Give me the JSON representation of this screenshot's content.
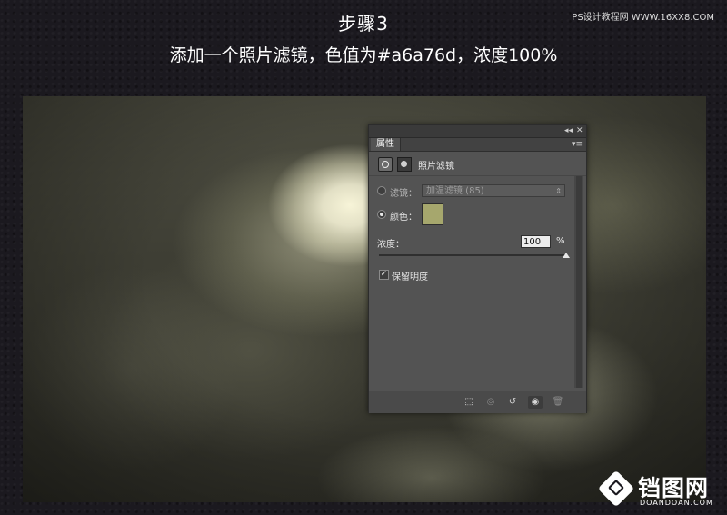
{
  "header": {
    "step_title": "步骤3",
    "description": "添加一个照片滤镜，色值为#a6a76d，浓度100%",
    "watermark": "PS设计教程网 WWW.16XX8.COM"
  },
  "panel": {
    "tab_label": "属性",
    "collapse_label": "◂◂",
    "close_label": "✕",
    "menu_label": "▾≡",
    "adjustment_name": "照片滤镜",
    "filter_label": "滤镜：",
    "filter_value": "加温滤镜 (85)",
    "color_label": "颜色：",
    "color_hex": "#a6a76d",
    "density_label": "浓度：",
    "density_value": "100",
    "density_unit": "%",
    "density_level": 1.0,
    "preserve_label": "保留明度",
    "preserve_checked": true,
    "filter_selected": false,
    "color_selected": true
  },
  "footer_icons": [
    {
      "name": "clip-to-layer-icon",
      "glyph": "⬚"
    },
    {
      "name": "view-previous-icon",
      "glyph": "◎"
    },
    {
      "name": "reset-icon",
      "glyph": "↺"
    },
    {
      "name": "visibility-icon",
      "glyph": "◉"
    },
    {
      "name": "delete-icon",
      "glyph": "🗑"
    }
  ],
  "logo": {
    "text": "铛图网",
    "sub": "DOANDOAN.COM"
  },
  "colors": {
    "panel_bg": "#535353",
    "swatch": "#a6a76d"
  }
}
